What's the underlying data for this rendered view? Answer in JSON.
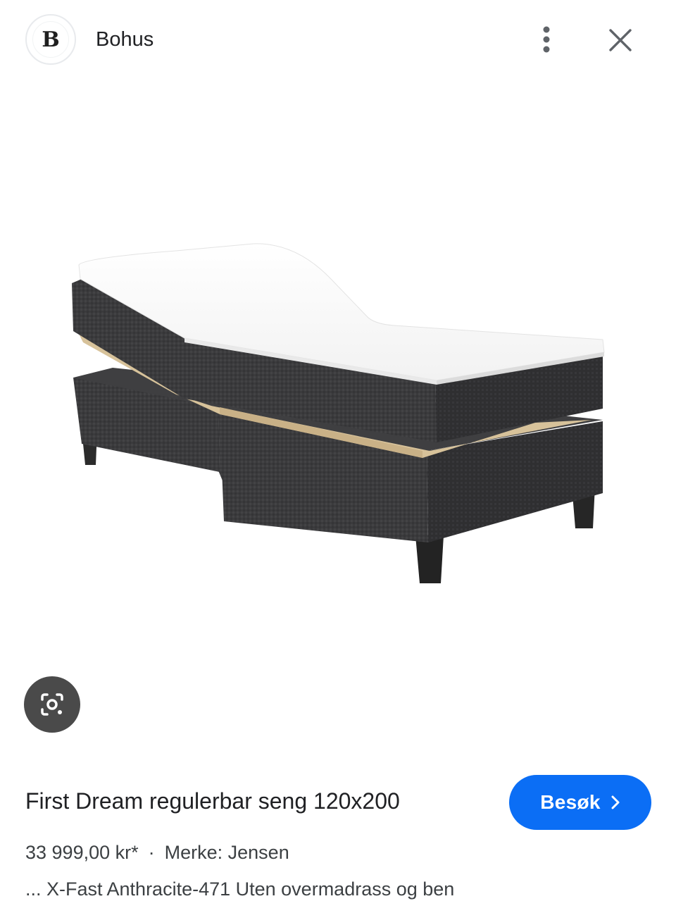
{
  "header": {
    "logo_letter": "B",
    "site_name": "Bohus",
    "more_icon": "more-vert-icon",
    "close_icon": "close-icon"
  },
  "image": {
    "subject": "adjustable-bed-photo"
  },
  "lens": {
    "icon": "lens-camera-icon"
  },
  "product": {
    "title": "First Dream regulerbar seng 120x200",
    "price": "33 999,00 kr*",
    "separator": "·",
    "brand": "Merke: Jensen",
    "description": "... X-Fast Anthracite-471 Uten overmadrass og ben"
  },
  "visit_button": {
    "label": "Besøk",
    "icon": "chevron-right-icon"
  },
  "colors": {
    "accent": "#0b6ef5",
    "fabric": "#3a3a3c",
    "lens_bg": "#4a4a4a"
  }
}
